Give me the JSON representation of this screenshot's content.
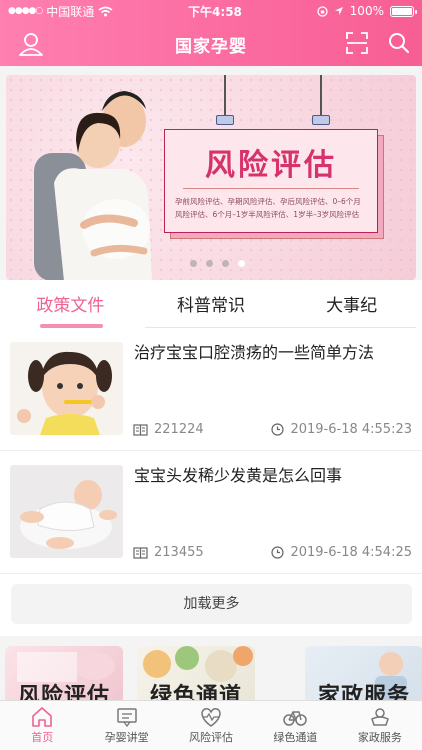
{
  "status": {
    "carrier": "中国联通",
    "time": "下午4:58",
    "battery": "100%"
  },
  "nav": {
    "title": "国家孕婴"
  },
  "banner": {
    "title": "风险评估",
    "description": "孕前风险评估、孕期风险评估、孕后风险评估、0–6个月风险评估、6个月–1岁半风险评估、1岁半–3岁风险评估",
    "dots": 4,
    "active_dot": 3
  },
  "tabs": [
    {
      "label": "政策文件",
      "active": true
    },
    {
      "label": "科普常识",
      "active": false
    },
    {
      "label": "大事纪",
      "active": false
    }
  ],
  "articles": [
    {
      "title": "治疗宝宝口腔溃疡的一些简单方法",
      "views": "221224",
      "time": "2019-6-18 4:55:23",
      "thumb": "toddler-brushing-teeth"
    },
    {
      "title": "宝宝头发稀少发黄是怎么回事",
      "views": "213455",
      "time": "2019-6-18 4:54:25",
      "thumb": "newborn-baby"
    }
  ],
  "load_more": "加载更多",
  "service_cards": [
    {
      "label": "风险评估"
    },
    {
      "label": "绿色通道"
    },
    {
      "label": "家政服务"
    }
  ],
  "tabbar": [
    {
      "label": "首页",
      "icon": "home-icon",
      "active": true
    },
    {
      "label": "孕婴讲堂",
      "icon": "lecture-icon",
      "active": false
    },
    {
      "label": "风险评估",
      "icon": "heartbeat-icon",
      "active": false
    },
    {
      "label": "绿色通道",
      "icon": "bicycle-icon",
      "active": false
    },
    {
      "label": "家政服务",
      "icon": "service-icon",
      "active": false
    }
  ],
  "colors": {
    "accent": "#f06292",
    "header": "#fb6a9f"
  }
}
